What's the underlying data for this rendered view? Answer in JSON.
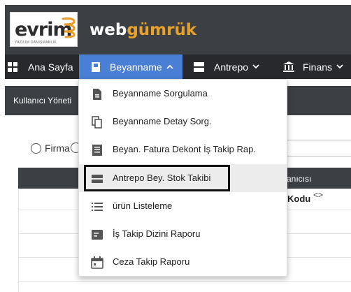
{
  "header": {
    "logo_word": "evrim",
    "logo_tag": "yazılım danışmanlık",
    "brand_prefix": "web",
    "brand_suffix": "gümrük"
  },
  "colors": {
    "header_bg": "#3c3f44",
    "nav_bg": "#27292d",
    "nav_active": "#4a7fd6",
    "brand_accent": "#e6a22d",
    "logo_accent": "#e89a2b"
  },
  "nav": {
    "items": [
      {
        "label": "Ana Sayfa",
        "icon": "dashboard-icon"
      },
      {
        "label": "Beyanname",
        "icon": "book-icon",
        "chevron": "up",
        "active": true
      },
      {
        "label": "Antrepo",
        "icon": "warehouse-icon",
        "chevron": "down"
      },
      {
        "label": "Finans",
        "icon": "bank-icon",
        "chevron": "down"
      }
    ]
  },
  "page": {
    "subheader_text": "Kullanıcı Yöneti",
    "radio_label": "Firma",
    "table_header_text": "anıcısı",
    "column_label": "Kodu",
    "sort_glyph": "<>"
  },
  "dropdown": {
    "items": [
      {
        "label": "Beyanname Sorgulama",
        "icon": "document-icon"
      },
      {
        "label": "Beyanname Detay Sorg.",
        "icon": "copy-icon"
      },
      {
        "label": "Beyan. Fatura Dekont İş Takip Rap.",
        "icon": "list-document-icon"
      },
      {
        "label": "Antrepo Bey. Stok Takibi",
        "icon": "stock-icon",
        "hovered": true
      },
      {
        "label": "ürün Listeleme",
        "icon": "list-icon"
      },
      {
        "label": "İş Takip Dizini Raporu",
        "icon": "folder-report-icon"
      },
      {
        "label": "Ceza Takip Raporu",
        "icon": "calendar-icon"
      }
    ]
  }
}
